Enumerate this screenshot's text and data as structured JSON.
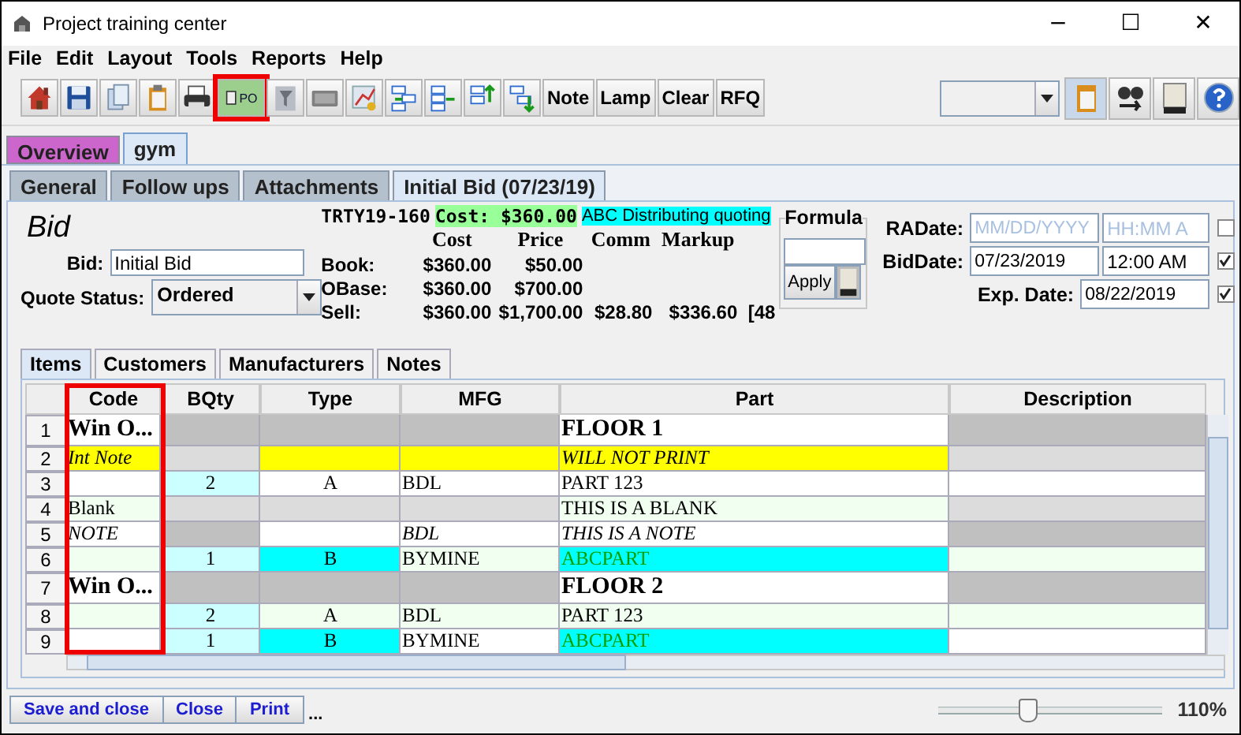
{
  "window": {
    "title": "Project training center",
    "controls": [
      "−",
      "☐",
      "✕"
    ]
  },
  "menu": [
    "File",
    "Edit",
    "Layout",
    "Tools",
    "Reports",
    "Help"
  ],
  "toolbar": {
    "items": [
      {
        "kind": "icon",
        "highlighted": false
      },
      {
        "kind": "icon",
        "highlighted": false
      },
      {
        "kind": "icon",
        "highlighted": false
      },
      {
        "kind": "icon",
        "highlighted": false
      },
      {
        "kind": "icon",
        "highlighted": false
      },
      {
        "kind": "po",
        "label": "PO",
        "highlighted": true
      },
      {
        "kind": "icon",
        "highlighted": false
      },
      {
        "kind": "icon",
        "highlighted": false
      },
      {
        "kind": "icon",
        "highlighted": false
      },
      {
        "kind": "icon",
        "highlighted": false
      },
      {
        "kind": "icon",
        "highlighted": false
      },
      {
        "kind": "icon",
        "highlighted": false
      },
      {
        "kind": "icon",
        "highlighted": false
      },
      {
        "kind": "text",
        "label": "Note",
        "highlighted": false
      },
      {
        "kind": "text",
        "label": "Lamp",
        "highlighted": false
      },
      {
        "kind": "text",
        "label": "Clear",
        "highlighted": false
      },
      {
        "kind": "text",
        "label": "RFQ",
        "highlighted": false
      }
    ],
    "right_tools": [
      {
        "selected": true
      },
      {
        "selected": false
      },
      {
        "selected": false
      },
      {
        "selected": false
      }
    ]
  },
  "tabs": [
    {
      "label": "Overview",
      "color": "#cc66cc",
      "selected": false
    },
    {
      "label": "gym",
      "color": "#dce8f5",
      "selected": true
    }
  ],
  "doc_tabs": [
    {
      "label": "General",
      "selected": false
    },
    {
      "label": "Follow ups",
      "selected": false
    },
    {
      "label": "Attachments",
      "selected": false
    },
    {
      "label": "Initial Bid (07/23/19)",
      "selected": true
    }
  ],
  "bid": {
    "heading": "Bid",
    "bid_label": "Bid:",
    "bid_value": "Initial Bid",
    "status_label": "Quote Status:",
    "status_value": "Ordered"
  },
  "summary": {
    "code": "TRTY19-160",
    "cost": "Cost: $360.00",
    "vendor": "ABC Distributing quoting"
  },
  "pricing": {
    "columns": [
      "Cost",
      "Price",
      "Comm",
      "Markup"
    ],
    "rows": [
      {
        "label": "Book:",
        "values": [
          "$360.00",
          "$50.00"
        ]
      },
      {
        "label": "OBase:",
        "values": [
          "$360.00",
          "$700.00"
        ]
      },
      {
        "label": "Sell:",
        "values": [
          "$360.00",
          "$1,700.00",
          "$28.80",
          "$336.60",
          "[48"
        ]
      }
    ]
  },
  "formula": {
    "title": "Formula",
    "button": "Apply"
  },
  "dates": [
    {
      "label": "RADate:",
      "date_placeholder": "MM/DD/YYYY",
      "time_placeholder": "HH:MM A",
      "checked": false
    },
    {
      "label": "BidDate:",
      "date": "07/23/2019",
      "time": "12:00 AM",
      "checked": true
    },
    {
      "label": "Exp. Date:",
      "date": "08/22/2019",
      "checked": true
    }
  ],
  "item_tabs": [
    {
      "label": "Items",
      "selected": true
    },
    {
      "label": "Customers",
      "selected": false
    },
    {
      "label": "Manufacturers",
      "selected": false
    },
    {
      "label": "Notes",
      "selected": false
    }
  ],
  "table": {
    "columns": [
      {
        "label": "Code",
        "highlighted": true
      },
      {
        "label": "BQty",
        "highlighted": false
      },
      {
        "label": "Type",
        "highlighted": false
      },
      {
        "label": "MFG",
        "highlighted": false
      },
      {
        "label": "Part",
        "highlighted": false
      },
      {
        "label": "Description",
        "highlighted": false
      }
    ],
    "rows": [
      {
        "number": "1",
        "kind": "group",
        "cells": [
          {
            "text": "Win O...",
            "color": "#ffffff"
          },
          {
            "color": "#c0c0c0"
          },
          {
            "color": "#c0c0c0"
          },
          {
            "color": "#c0c0c0"
          },
          {
            "text": "FLOOR 1",
            "color": "#ffffff"
          },
          {
            "color": "#c0c0c0"
          }
        ]
      },
      {
        "number": "2",
        "kind": "note",
        "cells": [
          {
            "text": "Int Note",
            "color": "#ffff00"
          },
          {
            "color": "#dcdcdc"
          },
          {
            "color": "#ffff00"
          },
          {
            "color": "#ffff00"
          },
          {
            "text": "WILL NOT PRINT",
            "color": "#ffff00"
          },
          {
            "color": "#dcdcdc"
          }
        ]
      },
      {
        "number": "3",
        "kind": "item",
        "cells": [
          {
            "color": "#ffffff"
          },
          {
            "text": "2",
            "color": "#ccffff"
          },
          {
            "text": "A",
            "color": "#ffffff"
          },
          {
            "text": "BDL",
            "color": "#ffffff"
          },
          {
            "text": "PART 123",
            "color": "#ffffff"
          },
          {
            "color": "#ffffff"
          }
        ]
      },
      {
        "number": "4",
        "kind": "item",
        "cells": [
          {
            "text": "Blank",
            "color": "#f0fff0"
          },
          {
            "color": "#dcdcdc"
          },
          {
            "color": "#dcdcdc"
          },
          {
            "color": "#dcdcdc"
          },
          {
            "text": "THIS IS A BLANK",
            "color": "#f0fff0"
          },
          {
            "color": "#dcdcdc"
          }
        ]
      },
      {
        "number": "5",
        "kind": "note",
        "cells": [
          {
            "text": "NOTE",
            "color": "#ffffff"
          },
          {
            "color": "#c0c0c0"
          },
          {
            "color": "#ffffff"
          },
          {
            "text": "BDL",
            "color": "#ffffff"
          },
          {
            "text": "THIS IS A NOTE",
            "color": "#ffffff"
          },
          {
            "color": "#c0c0c0"
          }
        ]
      },
      {
        "number": "6",
        "kind": "item",
        "cells": [
          {
            "color": "#f0fff0"
          },
          {
            "text": "1",
            "color": "#ccffff"
          },
          {
            "text": "B",
            "color": "#00ffff"
          },
          {
            "text": "BYMINE",
            "color": "#f0fff0"
          },
          {
            "text": "ABCPART",
            "color": "#00ffff",
            "green": true
          },
          {
            "color": "#f0fff0"
          }
        ]
      },
      {
        "number": "7",
        "kind": "group",
        "cells": [
          {
            "text": "Win O...",
            "color": "#ffffff"
          },
          {
            "color": "#c0c0c0"
          },
          {
            "color": "#c0c0c0"
          },
          {
            "color": "#c0c0c0"
          },
          {
            "text": "FLOOR 2",
            "color": "#ffffff"
          },
          {
            "color": "#c0c0c0"
          }
        ]
      },
      {
        "number": "8",
        "kind": "item",
        "cells": [
          {
            "color": "#f0fff0"
          },
          {
            "text": "2",
            "color": "#ccffff"
          },
          {
            "text": "A",
            "color": "#f0fff0"
          },
          {
            "text": "BDL",
            "color": "#f0fff0"
          },
          {
            "text": "PART 123",
            "color": "#f0fff0"
          },
          {
            "color": "#f0fff0"
          }
        ]
      },
      {
        "number": "9",
        "kind": "item",
        "cells": [
          {
            "color": "#ffffff"
          },
          {
            "text": "1",
            "color": "#ccffff"
          },
          {
            "text": "B",
            "color": "#00ffff"
          },
          {
            "text": "BYMINE",
            "color": "#ffffff"
          },
          {
            "text": "ABCPART",
            "color": "#00ffff",
            "green": true
          },
          {
            "color": "#ffffff"
          }
        ]
      }
    ]
  },
  "footer": {
    "buttons": [
      "Save and close",
      "Close",
      "Print"
    ],
    "more": "...",
    "zoom": {
      "level": 0.4,
      "reading": "110%"
    }
  }
}
